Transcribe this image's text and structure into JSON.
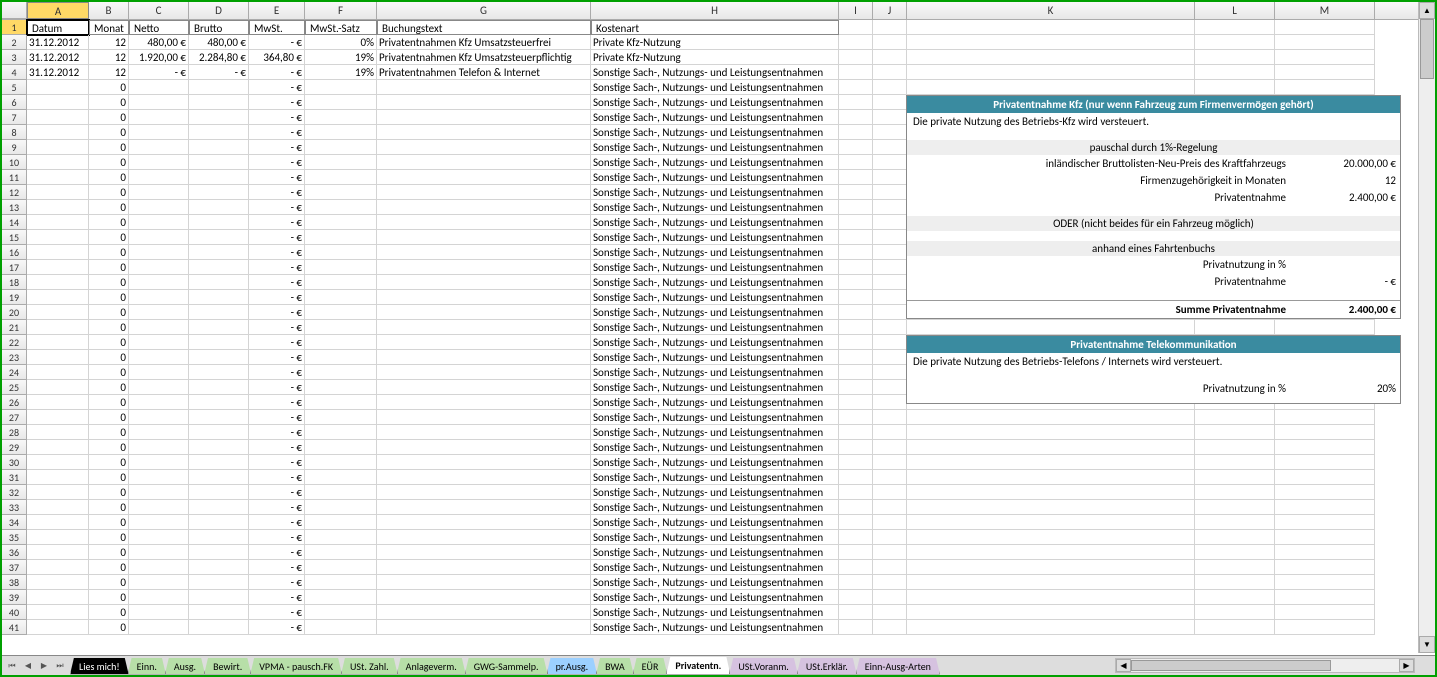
{
  "columns": [
    "A",
    "B",
    "C",
    "D",
    "E",
    "F",
    "G",
    "H",
    "I",
    "J",
    "K",
    "L",
    "M"
  ],
  "selectedCol": "A",
  "selectedRow": 1,
  "headers": {
    "A": "Datum",
    "B": "Monat",
    "C": "Netto",
    "D": "Brutto",
    "E": "MwSt.",
    "F": "MwSt.-Satz",
    "G": "Buchungstext",
    "H": "Kostenart"
  },
  "rows": [
    {
      "A": "31.12.2012",
      "B": "12",
      "C": "480,00 €",
      "D": "480,00 €",
      "E": "-   €",
      "F": "0%",
      "G": "Privatentnahmen Kfz Umsatzsteuerfrei",
      "H": "Private Kfz-Nutzung"
    },
    {
      "A": "31.12.2012",
      "B": "12",
      "C": "1.920,00 €",
      "D": "2.284,80 €",
      "E": "364,80 €",
      "F": "19%",
      "G": "Privatentnahmen Kfz Umsatzsteuerpflichtig",
      "H": "Private Kfz-Nutzung"
    },
    {
      "A": "31.12.2012",
      "B": "12",
      "C": "-   €",
      "D": "-   €",
      "E": "-   €",
      "F": "19%",
      "G": "Privatentnahmen Telefon & Internet",
      "H": "Sonstige Sach-, Nutzungs- und Leistungsentnahmen"
    }
  ],
  "fillerRow": {
    "B": "0",
    "E": "-   €",
    "H": "Sonstige Sach-, Nutzungs- und Leistungsentnahmen"
  },
  "box1": {
    "title": "Privatentnahme Kfz (nur wenn Fahrzeug zum Firmenvermögen gehört)",
    "desc": "Die private Nutzung des Betriebs-Kfz wird versteuert.",
    "sub1": "pauschal durch 1%-Regelung",
    "l1": "inländischer Bruttolisten-Neu-Preis des Kraftfahrzeugs",
    "v1": "20.000,00 €",
    "l2": "Firmenzugehörigkeit in Monaten",
    "v2": "12",
    "l3": "Privatentnahme",
    "v3": "2.400,00 €",
    "sub2": "ODER (nicht beides für ein Fahrzeug möglich)",
    "sub3": "anhand eines Fahrtenbuchs",
    "l4": "Privatnutzung in %",
    "v4": "",
    "l5": "Privatentnahme",
    "v5": "-   €",
    "l6": "Summe Privatentnahme",
    "v6": "2.400,00 €"
  },
  "box2": {
    "title": "Privatentnahme Telekommunikation",
    "desc": "Die private Nutzung des Betriebs-Telefons / Internets wird versteuert.",
    "l1": "Privatnutzung in %",
    "v1": "20%"
  },
  "tabs": [
    {
      "label": "Lies mich!",
      "color": "#000",
      "fg": "#fff"
    },
    {
      "label": "Einn.",
      "color": "#b7dfa8"
    },
    {
      "label": "Ausg.",
      "color": "#b7dfa8"
    },
    {
      "label": "Bewirt.",
      "color": "#b7dfa8"
    },
    {
      "label": "VPMA - pausch.FK",
      "color": "#b7dfa8"
    },
    {
      "label": "USt. Zahl.",
      "color": "#b7dfa8"
    },
    {
      "label": "Anlageverm.",
      "color": "#b7dfa8"
    },
    {
      "label": "GWG-Sammelp.",
      "color": "#b7dfa8"
    },
    {
      "label": "pr.Ausg.",
      "color": "#9cd0ff"
    },
    {
      "label": "BWA",
      "color": "#b7dfa8"
    },
    {
      "label": "EÜR",
      "color": "#b7dfa8"
    },
    {
      "label": "Privatentn.",
      "color": "#fff",
      "active": true
    },
    {
      "label": "USt.Voranm.",
      "color": "#d6c2e0"
    },
    {
      "label": "USt.Erklär.",
      "color": "#d6c2e0"
    },
    {
      "label": "Einn-Ausg-Arten",
      "color": "#d6c2e0"
    }
  ]
}
